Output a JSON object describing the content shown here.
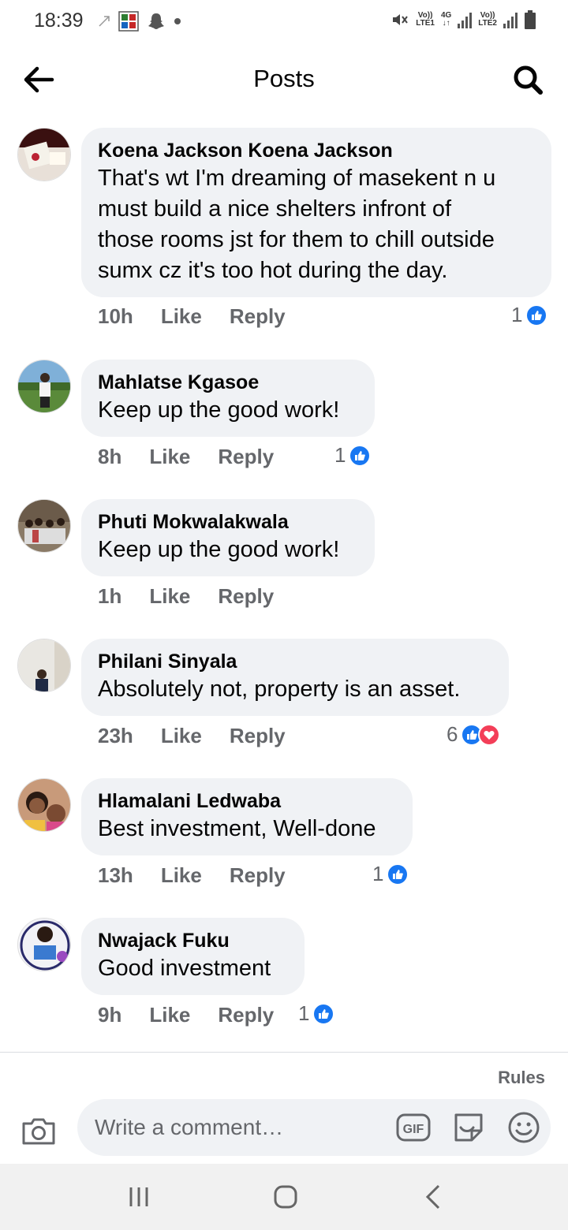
{
  "status_bar": {
    "time": "18:39",
    "sim1_label_top": "Vo))",
    "sim1_label_bottom": "LTE1",
    "network_type": "4G",
    "sim2_label_top": "Vo))",
    "sim2_label_bottom": "LTE2"
  },
  "header": {
    "title": "Posts"
  },
  "colors": {
    "bubble_bg": "#f0f2f5",
    "meta_text": "#65676b",
    "like_blue": "#1877f2",
    "love_red": "#f33e58"
  },
  "comments": [
    {
      "author": "Koena Jackson Koena Jackson",
      "lines": [
        "That's wt I'm dreaming of masekent n u",
        "must build a nice shelters infront of",
        "those rooms jst for them to chill outside",
        "sumx  cz it's too hot during the day."
      ],
      "time": "10h",
      "like_label": "Like",
      "reply_label": "Reply",
      "reaction_count": "1",
      "reactions": [
        "like"
      ]
    },
    {
      "author": "Mahlatse Kgasoe",
      "lines": [
        "Keep up the good work!"
      ],
      "time": "8h",
      "like_label": "Like",
      "reply_label": "Reply",
      "reaction_count": "1",
      "reactions": [
        "like"
      ]
    },
    {
      "author": "Phuti Mokwalakwala",
      "lines": [
        "Keep up the good work!"
      ],
      "time": "1h",
      "like_label": "Like",
      "reply_label": "Reply",
      "reaction_count": "",
      "reactions": []
    },
    {
      "author": "Philani Sinyala",
      "lines": [
        "Absolutely not, property is an asset."
      ],
      "time": "23h",
      "like_label": "Like",
      "reply_label": "Reply",
      "reaction_count": "6",
      "reactions": [
        "like",
        "love"
      ]
    },
    {
      "author": "Hlamalani Ledwaba",
      "lines": [
        "Best investment, Well-done"
      ],
      "time": "13h",
      "like_label": "Like",
      "reply_label": "Reply",
      "reaction_count": "1",
      "reactions": [
        "like"
      ]
    },
    {
      "author": "Nwajack Fuku",
      "lines": [
        "Good investment"
      ],
      "time": "9h",
      "like_label": "Like",
      "reply_label": "Reply",
      "reaction_count": "1",
      "reactions": [
        "like"
      ]
    }
  ],
  "composer": {
    "rules_label": "Rules",
    "placeholder": "Write a comment…",
    "gif_label": "GIF"
  }
}
